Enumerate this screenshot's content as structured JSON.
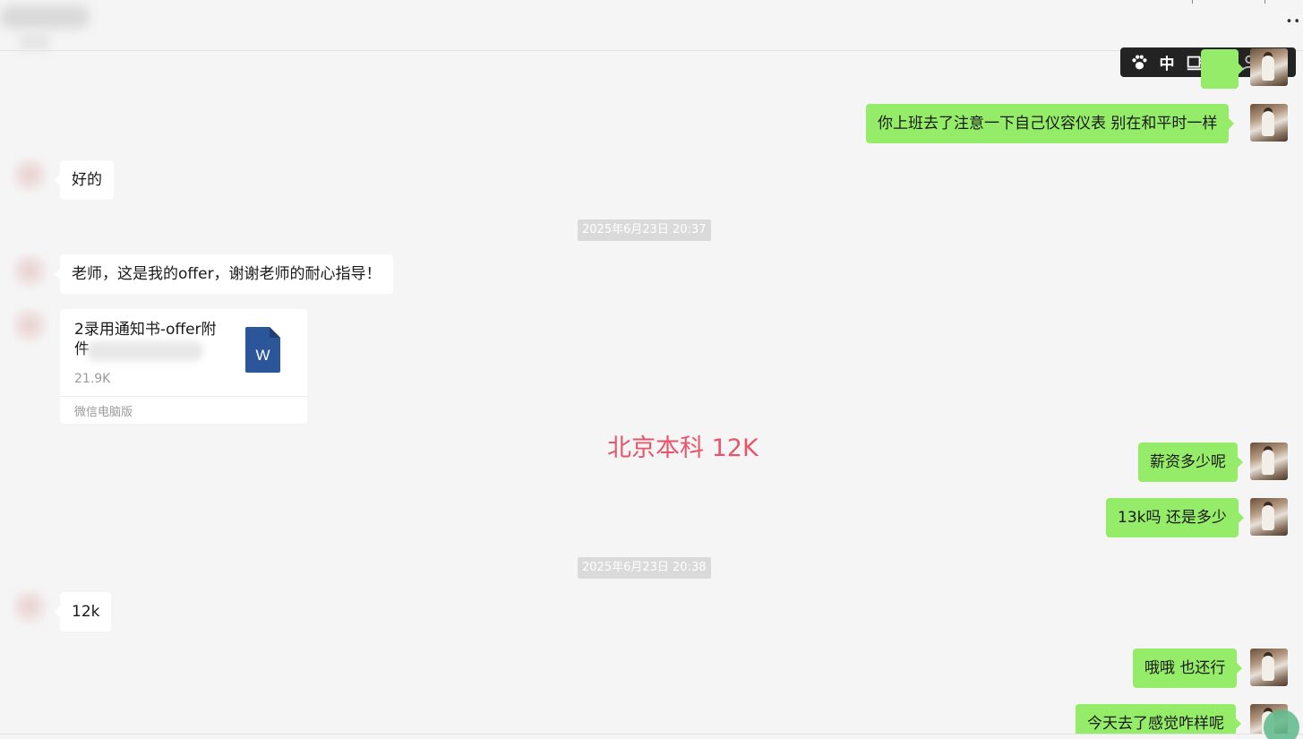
{
  "header": {
    "title": "",
    "more_icon": "more-dots-icon"
  },
  "ime_toolbar": {
    "items": [
      {
        "icon": "paw-icon",
        "label": ""
      },
      {
        "icon": "chinese-mode-icon",
        "label": "中"
      },
      {
        "icon": "keyboard-icon",
        "label": ""
      },
      {
        "icon": "moon-icon",
        "label": ""
      },
      {
        "icon": "user-icon",
        "label": ""
      },
      {
        "icon": "grid-icon",
        "label": ""
      }
    ]
  },
  "messages": {
    "m1": {
      "text": "你上班去了注意一下自己仪容仪表 别在和平时一样"
    },
    "m2": {
      "text": "好的"
    },
    "ts1": {
      "text": "2025年6月23日 20:37"
    },
    "m3": {
      "text": "老师，这是我的offer，谢谢老师的耐心指导！"
    },
    "file": {
      "name": "2录用通知书-offer附件",
      "size": "21.9K",
      "source": "微信电脑版",
      "icon_letter": "W"
    },
    "m4": {
      "text": "薪资多少呢"
    },
    "m5": {
      "text": "13k吗 还是多少"
    },
    "ts2": {
      "text": "2025年6月23日 20:38"
    },
    "m6": {
      "text": "12k"
    },
    "m7": {
      "text": "哦哦 也还行"
    },
    "m8": {
      "text": "今天去了感觉咋样呢"
    }
  },
  "overlay": {
    "text": "北京本科 12K",
    "color": "#e8556b"
  },
  "colors": {
    "outgoing_bubble": "#95ec69",
    "incoming_bubble": "#ffffff",
    "background": "#f5f5f5"
  }
}
